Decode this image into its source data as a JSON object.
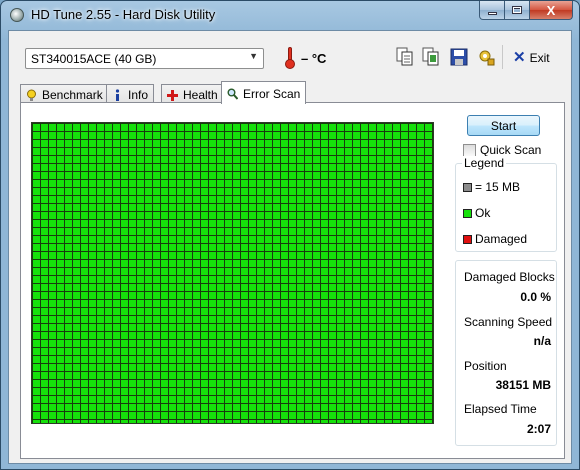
{
  "window": {
    "title": "HD Tune 2.55 - Hard Disk Utility",
    "close_glyph": "X"
  },
  "toolbar": {
    "drive_selected": "ST340015ACE (40 GB)",
    "temperature": "– °C",
    "exit_label": "Exit",
    "icons": [
      "copy-info-icon",
      "copy-screenshot-icon",
      "save-icon",
      "options-icon",
      "exit-icon"
    ]
  },
  "tabs": [
    {
      "label": "Benchmark",
      "icon": "benchmark-icon",
      "active": false
    },
    {
      "label": "Info",
      "icon": "info-icon",
      "active": false
    },
    {
      "label": "Health",
      "icon": "health-icon",
      "active": false
    },
    {
      "label": "Error Scan",
      "icon": "search-icon",
      "active": true
    }
  ],
  "error_scan": {
    "start_label": "Start",
    "quick_scan_label": "Quick Scan",
    "quick_scan_checked": false,
    "legend": {
      "title": "Legend",
      "items": [
        {
          "label": "= 15 MB",
          "color": "#8c8c8c"
        },
        {
          "label": "Ok",
          "color": "#16e10b"
        },
        {
          "label": "Damaged",
          "color": "#e01010"
        }
      ]
    },
    "stats": {
      "damaged_blocks_label": "Damaged Blocks",
      "damaged_blocks_value": "0.0 %",
      "scanning_speed_label": "Scanning Speed",
      "scanning_speed_value": "n/a",
      "position_label": "Position",
      "position_value": "38151 MB",
      "elapsed_time_label": "Elapsed Time",
      "elapsed_time_value": "2:07"
    },
    "block_map": {
      "status": "Ok",
      "ok_color": "#16e10b"
    }
  }
}
